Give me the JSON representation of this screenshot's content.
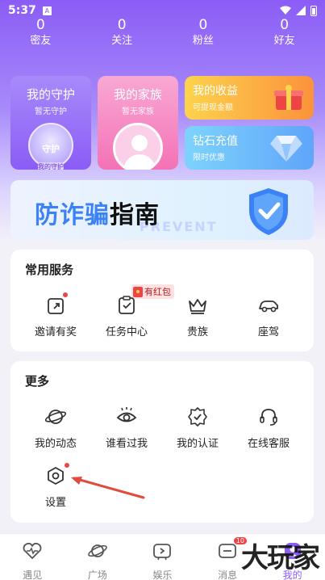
{
  "status": {
    "time": "5:37",
    "app_badge": "A"
  },
  "stats": [
    {
      "num": "0",
      "label": "密友"
    },
    {
      "num": "0",
      "label": "关注"
    },
    {
      "num": "0",
      "label": "粉丝"
    },
    {
      "num": "0",
      "label": "好友"
    }
  ],
  "cards": {
    "guard": {
      "title": "我的守护",
      "sub": "暂无守护",
      "badge_text": "守护",
      "badge_sub": "我的守护"
    },
    "family": {
      "title": "我的家族",
      "sub": "暂无家族"
    },
    "income": {
      "title": "我的收益",
      "sub": "可提现金额"
    },
    "diamond": {
      "title": "钻石充值",
      "sub": "限时优惠"
    }
  },
  "banner": {
    "title_part1": "防诈骗",
    "title_part2": "指南",
    "watermark": "PREVENT"
  },
  "services": {
    "title": "常用服务",
    "tag": "有红包",
    "items": [
      {
        "label": "邀请有奖",
        "icon": "invite-icon"
      },
      {
        "label": "任务中心",
        "icon": "task-icon"
      },
      {
        "label": "贵族",
        "icon": "crown-icon"
      },
      {
        "label": "座驾",
        "icon": "car-icon"
      }
    ]
  },
  "more": {
    "title": "更多",
    "items": [
      {
        "label": "我的动态",
        "icon": "planet-icon"
      },
      {
        "label": "谁看过我",
        "icon": "eye-icon"
      },
      {
        "label": "我的认证",
        "icon": "verified-icon"
      },
      {
        "label": "在线客服",
        "icon": "headset-icon"
      },
      {
        "label": "设置",
        "icon": "settings-icon"
      }
    ]
  },
  "tabbar": {
    "tabs": [
      {
        "label": "遇见",
        "icon": "heart-pulse-icon"
      },
      {
        "label": "广场",
        "icon": "planet-icon"
      },
      {
        "label": "娱乐",
        "icon": "tv-icon"
      },
      {
        "label": "消息",
        "icon": "message-icon",
        "badge": "10"
      },
      {
        "label": "我的",
        "icon": "profile-icon"
      }
    ],
    "active_index": 4
  },
  "watermark": "大玩家",
  "colors": {
    "accent": "#8b5cf6",
    "alert": "#ef4444"
  }
}
